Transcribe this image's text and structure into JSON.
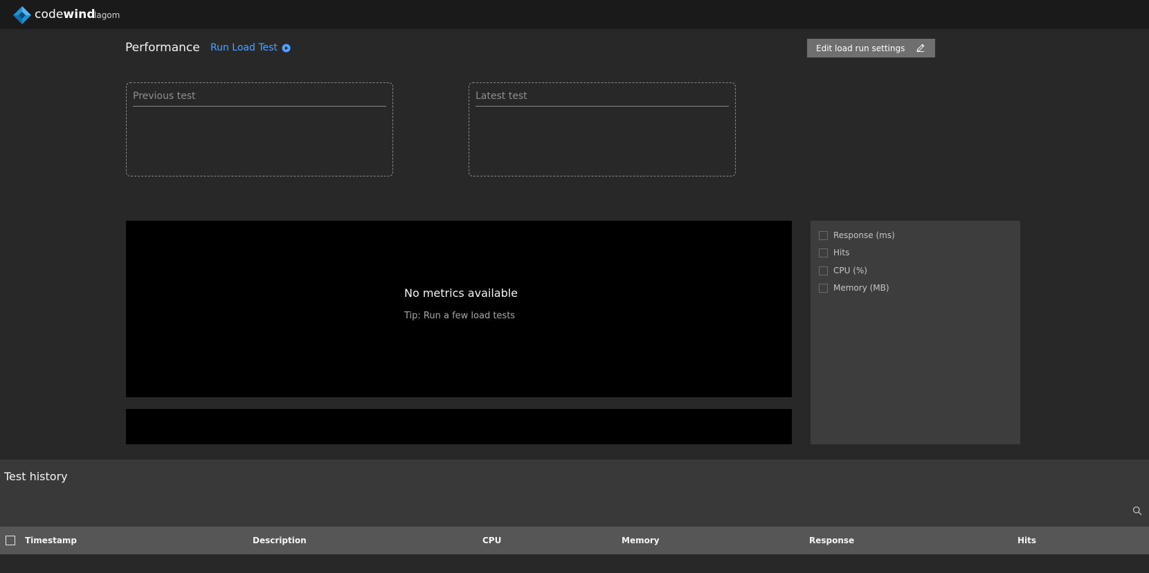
{
  "app": {
    "brand_plain": "code",
    "brand_bold": "wind",
    "project": "lagom"
  },
  "header": {
    "title": "Performance",
    "run_label": "Run Load Test",
    "edit_label": "Edit load run settings"
  },
  "tests": {
    "previous_title": "Previous test",
    "latest_title": "Latest test"
  },
  "chart": {
    "empty_title": "No metrics available",
    "empty_tip": "Tip: Run a few load tests"
  },
  "legend": {
    "items": [
      "Response (ms)",
      "Hits",
      "CPU (%)",
      "Memory (MB)"
    ]
  },
  "history": {
    "title": "Test history",
    "columns": [
      "Timestamp",
      "Description",
      "CPU",
      "Memory",
      "Response",
      "Hits"
    ]
  },
  "colors": {
    "accent": "#4da3ff",
    "brand_blue": "#1f8fd6"
  },
  "icons": [
    "codewind-logo-icon",
    "play-circle-icon",
    "pencil-icon",
    "search-icon"
  ]
}
